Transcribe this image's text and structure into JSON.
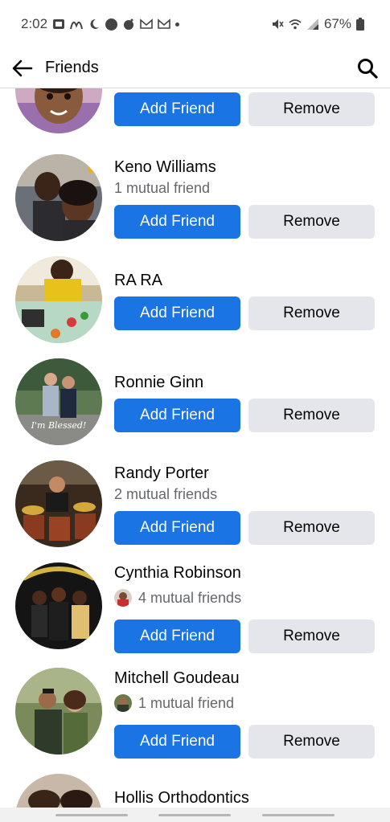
{
  "status_bar": {
    "time": "2:02",
    "battery": "67%"
  },
  "header": {
    "title": "Friends"
  },
  "people": [
    {
      "name": "",
      "mutual": "",
      "add_label": "Add Friend",
      "remove_label": "Remove"
    },
    {
      "name": "Keno Williams",
      "mutual": "1 mutual friend",
      "add_label": "Add Friend",
      "remove_label": "Remove"
    },
    {
      "name": "RA RA",
      "mutual": "",
      "add_label": "Add Friend",
      "remove_label": "Remove"
    },
    {
      "name": "Ronnie Ginn",
      "mutual": "",
      "add_label": "Add Friend",
      "remove_label": "Remove"
    },
    {
      "name": "Randy Porter",
      "mutual": "2 mutual friends",
      "add_label": "Add Friend",
      "remove_label": "Remove"
    },
    {
      "name": "Cynthia Robinson",
      "mutual": "4 mutual friends",
      "add_label": "Add Friend",
      "remove_label": "Remove"
    },
    {
      "name": "Mitchell Goudeau",
      "mutual": "1 mutual friend",
      "add_label": "Add Friend",
      "remove_label": "Remove"
    },
    {
      "name": "Hollis Orthodontics",
      "mutual": "",
      "add_label": "",
      "remove_label": ""
    }
  ],
  "avatar_overlay_text": "I'm Blessed!",
  "colors": {
    "primary_button": "#1b74e4",
    "secondary_button": "#e4e6eb",
    "secondary_text": "#65676b"
  }
}
